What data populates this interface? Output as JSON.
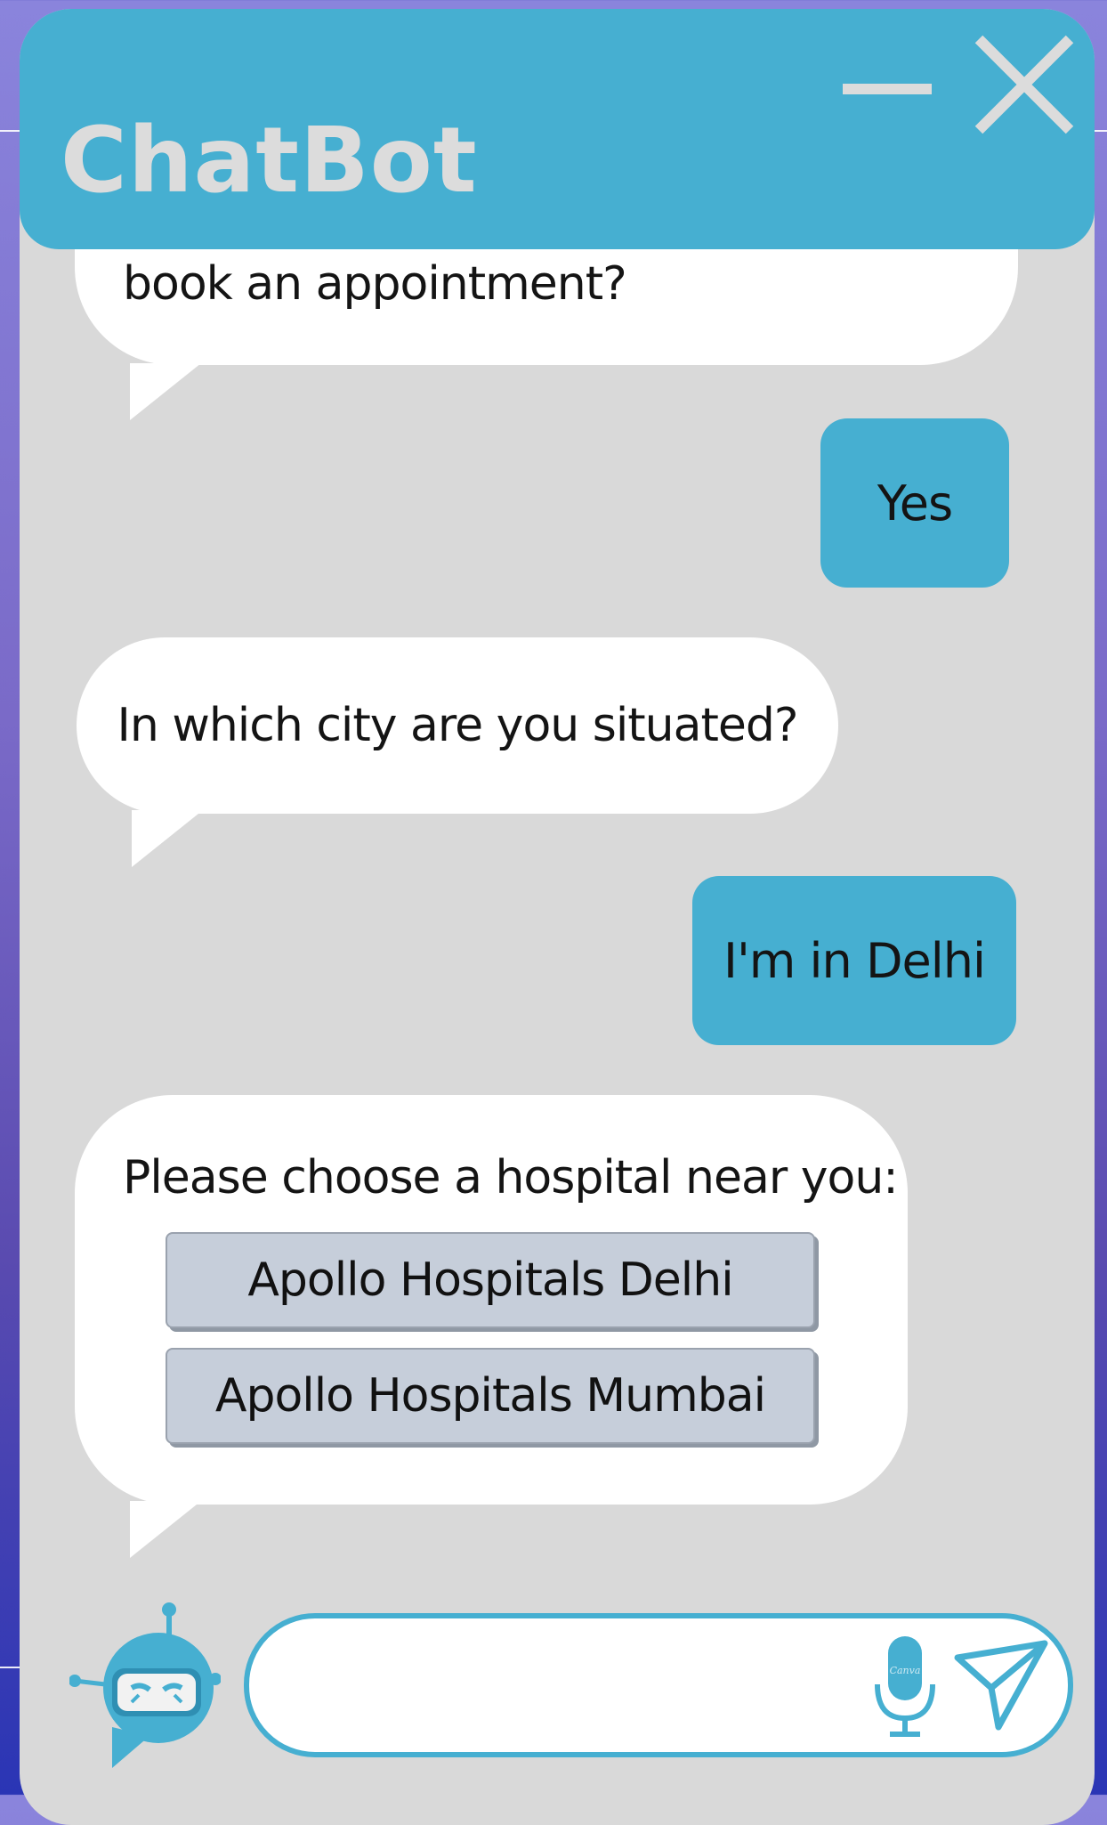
{
  "header": {
    "title": "ChatBot",
    "minimize_icon": "minimize-icon",
    "close_icon": "close-icon"
  },
  "messages": [
    {
      "from": "bot",
      "text": "book an appointment?"
    },
    {
      "from": "user",
      "text": "Yes"
    },
    {
      "from": "bot",
      "text": "In which city are you situated?"
    },
    {
      "from": "user",
      "text": "I'm in Delhi"
    },
    {
      "from": "bot",
      "text": "Please choose a hospital near you:",
      "options": [
        "Apollo Hospitals Delhi",
        "Apollo Hospitals Mumbai"
      ]
    }
  ],
  "input": {
    "value": "",
    "placeholder": "",
    "mic_icon": "microphone-icon",
    "send_icon": "send-icon",
    "mic_badge": "Canva"
  },
  "avatar": {
    "icon": "robot-icon"
  },
  "colors": {
    "accent": "#46afd1",
    "panel": "#d9d9d9",
    "title_text": "#dcdcdc",
    "option_button": "#c6ceda"
  }
}
